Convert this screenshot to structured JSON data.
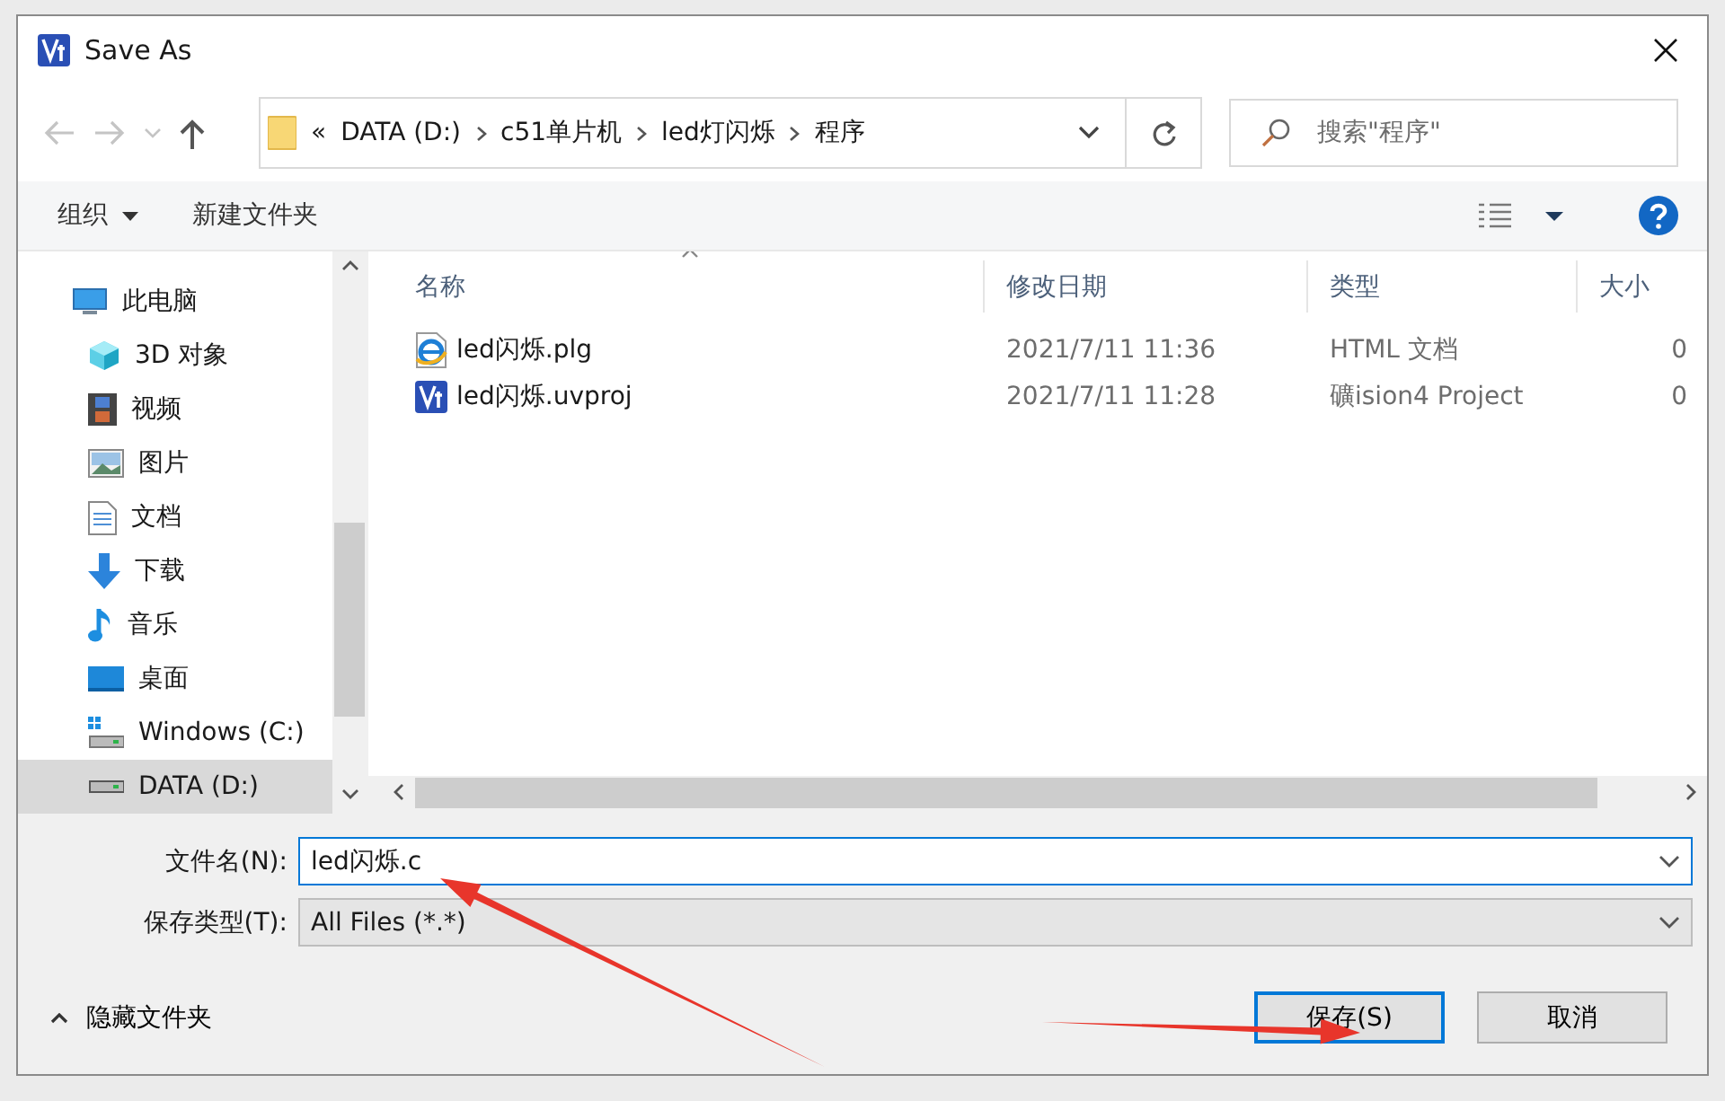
{
  "window": {
    "title": "Save As"
  },
  "address_bar": {
    "segments": [
      "«",
      "DATA (D:)",
      "c51单片机",
      "led灯闪烁",
      "程序"
    ]
  },
  "search": {
    "placeholder": "搜索\"程序\""
  },
  "toolbar": [
    {
      "label": "组织",
      "dropdown": true
    },
    {
      "label": "新建文件夹",
      "dropdown": false
    }
  ],
  "sidebar": {
    "items": [
      {
        "label": "此电脑",
        "kind": "computer",
        "selected": false,
        "children": [
          {
            "label": "3D 对象",
            "kind": "cube",
            "selected": false
          },
          {
            "label": "视频",
            "kind": "film",
            "selected": false
          },
          {
            "label": "图片",
            "kind": "image",
            "selected": false
          },
          {
            "label": "文档",
            "kind": "document",
            "selected": false
          },
          {
            "label": "下载",
            "kind": "download",
            "selected": false
          },
          {
            "label": "音乐",
            "kind": "music",
            "selected": false
          },
          {
            "label": "桌面",
            "kind": "desktop",
            "selected": false
          },
          {
            "label": "Windows (C:)",
            "kind": "system-drive",
            "selected": false
          },
          {
            "label": "DATA (D:)",
            "kind": "drive",
            "selected": true
          }
        ]
      }
    ]
  },
  "table": {
    "columns": [
      {
        "label": "名称",
        "sorted": true
      },
      {
        "label": "修改日期",
        "sorted": false
      },
      {
        "label": "类型",
        "sorted": false
      },
      {
        "label": "大小",
        "sorted": false
      }
    ],
    "rows": [
      {
        "kind": "web",
        "name": "led闪烁.plg",
        "date": "2021/7/11 11:36",
        "type": "HTML 文档",
        "size": "0"
      },
      {
        "kind": "project",
        "name": "led闪烁.uvproj",
        "date": "2021/7/11 11:28",
        "type": "礦ision4 Project",
        "size": "0"
      }
    ]
  },
  "file_name": {
    "label": "文件名(N):",
    "value": "led闪烁.c"
  },
  "file_type": {
    "label": "保存类型(T):",
    "value": "All Files (*.*)"
  },
  "hide_folders": "隐藏文件夹",
  "buttons": [
    {
      "label": "保存(S)",
      "default": true
    },
    {
      "label": "取消",
      "default": false
    }
  ],
  "annotations": [
    {
      "kind": "arrow"
    },
    {
      "kind": "arrow"
    }
  ]
}
